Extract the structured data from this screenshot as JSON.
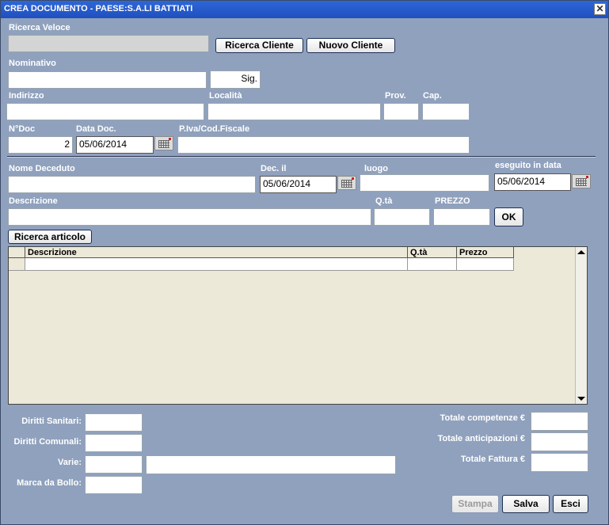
{
  "window": {
    "title": "CREA DOCUMENTO -  PAESE:S.A.LI BATTIATI",
    "close_glyph": "✕"
  },
  "search": {
    "label": "Ricerca Veloce",
    "value": "",
    "btn_search_customer": "Ricerca Cliente",
    "btn_new_customer": "Nuovo Cliente"
  },
  "customer": {
    "nominativo_label": "Nominativo",
    "nominativo_value": "",
    "title_value": "Sig.",
    "indirizzo_label": "Indirizzo",
    "indirizzo_value": "",
    "localita_label": "Località",
    "localita_value": "",
    "prov_label": "Prov.",
    "prov_value": "",
    "cap_label": "Cap.",
    "cap_value": ""
  },
  "doc": {
    "ndoc_label": "N°Doc",
    "ndoc_value": "2",
    "data_label": "Data Doc.",
    "data_value": "05/06/2014",
    "piva_label": "P.Iva/Cod.Fiscale",
    "piva_value": ""
  },
  "deceased": {
    "nome_label": "Nome Deceduto",
    "nome_value": "",
    "dec_label": "Dec. il",
    "dec_value": "05/06/2014",
    "luogo_label": "luogo",
    "luogo_value": "",
    "eseguito_label": "eseguito in data",
    "eseguito_value": "05/06/2014"
  },
  "item": {
    "descr_label": "Descrizione",
    "descr_value": "",
    "qta_label": "Q.tà",
    "qta_value": "",
    "prezzo_label": "PREZZO",
    "prezzo_value": "",
    "ok_label": "OK",
    "search_article_label": "Ricerca articolo"
  },
  "table": {
    "columns": [
      "Descrizione",
      "Q.tà",
      "Prezzo"
    ]
  },
  "fees": {
    "sanitari_label": "Diritti Sanitari:",
    "sanitari_value": "",
    "comunali_label": "Diritti Comunali:",
    "comunali_value": "",
    "varie_label": "Varie:",
    "varie_value": "",
    "varie_note": "",
    "bollo_label": "Marca da Bollo:",
    "bollo_value": ""
  },
  "totals": {
    "competenze_label": "Totale competenze €",
    "competenze_value": "",
    "anticipazioni_label": "Totale anticipazioni  €",
    "anticipazioni_value": "",
    "fattura_label": "Totale Fattura €",
    "fattura_value": ""
  },
  "actions": {
    "print_label": "Stampa",
    "save_label": "Salva",
    "exit_label": "Esci"
  }
}
